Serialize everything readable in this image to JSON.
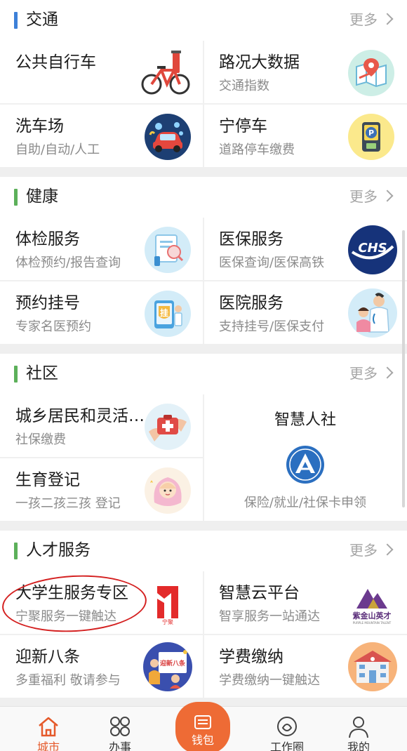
{
  "colors": {
    "accent_orange": "#e5592a",
    "section_bar_blue": "#3d80d8",
    "section_bar_green": "#5cb05a",
    "highlight_ellipse": "#d42020"
  },
  "more_label": "更多",
  "sections": {
    "transport": {
      "title": "交通",
      "items": [
        {
          "title": "公共自行车",
          "subtitle": "",
          "icon": "bicycle-icon"
        },
        {
          "title": "路况大数据",
          "subtitle": "交通指数",
          "icon": "map-pin-icon"
        },
        {
          "title": "洗车场",
          "subtitle": "自助/自动/人工",
          "icon": "car-wash-icon"
        },
        {
          "title": "宁停车",
          "subtitle": "道路停车缴费",
          "icon": "parking-icon"
        }
      ]
    },
    "health": {
      "title": "健康",
      "items": [
        {
          "title": "体检服务",
          "subtitle": "体检预约/报告查询",
          "icon": "medical-checkup-icon"
        },
        {
          "title": "医保服务",
          "subtitle": "医保查询/医保高铁",
          "icon": "chs-logo-icon",
          "logo_text": "CHS"
        },
        {
          "title": "预约挂号",
          "subtitle": "专家名医预约",
          "icon": "registration-icon",
          "badge_text": "挂"
        },
        {
          "title": "医院服务",
          "subtitle": "支持挂号/医保支付",
          "icon": "doctor-icon"
        }
      ]
    },
    "community": {
      "title": "社区",
      "items": [
        {
          "title": "城乡居民和灵活…",
          "subtitle": "社保缴费",
          "icon": "medical-kit-icon"
        },
        {
          "title": "生育登记",
          "subtitle": "一孩二孩三孩 登记",
          "icon": "baby-icon"
        }
      ],
      "feature": {
        "title": "智慧人社",
        "subtitle": "保险/就业/社保卡申领",
        "icon": "social-security-logo-icon"
      }
    },
    "talent": {
      "title": "人才服务",
      "items": [
        {
          "title": "大学生服务专区",
          "subtitle": "宁聚服务一键触达",
          "icon": "ningju-logo-icon",
          "logo_text": "宁聚"
        },
        {
          "title": "智慧云平台",
          "subtitle": "智享服务一站通达",
          "icon": "zijinshan-logo-icon",
          "logo_text": "紫金山英才",
          "logo_subtext": "PURPLE MOUNTAIN TALENT"
        },
        {
          "title": "迎新八条",
          "subtitle": "多重福利 敬请参与",
          "icon": "welcome-banner-icon",
          "banner_text": "迎新八条"
        },
        {
          "title": "学费缴纳",
          "subtitle": "学费缴纳一键触达",
          "icon": "school-building-icon"
        }
      ]
    }
  },
  "tabbar": {
    "items": [
      {
        "label": "城市",
        "icon": "home-icon",
        "active": true
      },
      {
        "label": "办事",
        "icon": "grid-icon",
        "active": false
      },
      {
        "label": "钱包",
        "icon": "wallet-icon",
        "active": false
      },
      {
        "label": "工作圈",
        "icon": "chat-icon",
        "active": false
      },
      {
        "label": "我的",
        "icon": "user-icon",
        "active": false
      }
    ]
  }
}
